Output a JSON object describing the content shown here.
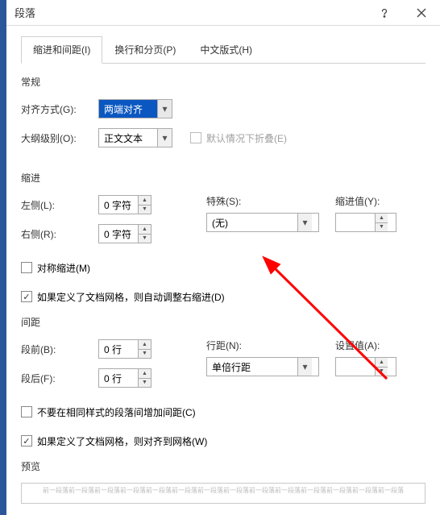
{
  "titlebar": {
    "title": "段落"
  },
  "tabs": {
    "t1": "缩进和间距(I)",
    "t2": "换行和分页(P)",
    "t3": "中文版式(H)"
  },
  "sections": {
    "general": "常规",
    "indent": "缩进",
    "spacing": "间距",
    "preview": "预览"
  },
  "general": {
    "align_label": "对齐方式(G):",
    "align_value": "两端对齐",
    "outline_label": "大纲级别(O):",
    "outline_value": "正文文本",
    "collapsed_label": "默认情况下折叠(E)"
  },
  "indent": {
    "left_label": "左侧(L):",
    "left_value": "0 字符",
    "right_label": "右侧(R):",
    "right_value": "0 字符",
    "special_label": "特殊(S):",
    "special_value": "(无)",
    "indentval_label": "缩进值(Y):",
    "indentval_value": "",
    "mirror_label": "对称缩进(M)",
    "grid_label": "如果定义了文档网格，则自动调整右缩进(D)"
  },
  "spacing": {
    "before_label": "段前(B):",
    "before_value": "0 行",
    "after_label": "段后(F):",
    "after_value": "0 行",
    "linespace_label": "行距(N):",
    "linespace_value": "单倍行距",
    "setval_label": "设置值(A):",
    "setval_value": "",
    "nosame_label": "不要在相同样式的段落间增加间距(C)",
    "grid_label": "如果定义了文档网格，则对齐到网格(W)"
  },
  "preview_text": "前一段落前一段落前一段落前一段落前一段落前一段落前一段落前一段落前一段落前一段落前一段落前一段落前一段落前一段落"
}
